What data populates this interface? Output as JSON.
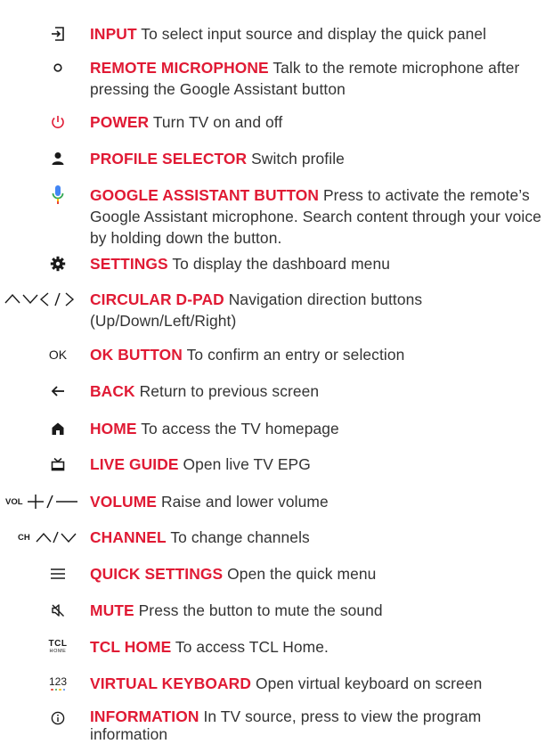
{
  "colors": {
    "accent": "#e01a34",
    "text": "#333333",
    "icon": "#1a1a1a"
  },
  "items": [
    {
      "icon": "input-icon",
      "label": "INPUT",
      "desc": "To select input source and display the quick panel"
    },
    {
      "icon": "microphone-dot-icon",
      "label": "REMOTE MICROPHONE",
      "desc": "Talk to the remote microphone after pressing the Google Assistant button"
    },
    {
      "icon": "power-icon",
      "label": "POWER",
      "desc": "Turn TV on and off"
    },
    {
      "icon": "profile-icon",
      "label": "PROFILE SELECTOR",
      "desc": "Switch profile"
    },
    {
      "icon": "google-assistant-icon",
      "label": "GOOGLE ASSISTANT BUTTON",
      "desc": "Press to activate the remote’s Google Assistant microphone. Search content through your voice by holding down the button."
    },
    {
      "icon": "settings-gear-icon",
      "label": "SETTINGS",
      "desc": "To display the dashboard menu"
    },
    {
      "icon": "dpad-arrows-icon",
      "label": "CIRCULAR D-PAD",
      "desc": "Navigation direction buttons (Up/Down/Left/Right)"
    },
    {
      "icon": "ok-icon",
      "icon_text": "OK",
      "label": "OK BUTTON",
      "desc": "To confirm an entry or selection"
    },
    {
      "icon": "back-arrow-icon",
      "label": "BACK",
      "desc": "Return to previous screen"
    },
    {
      "icon": "home-icon",
      "label": "HOME",
      "desc": "To access the TV homepage"
    },
    {
      "icon": "live-guide-icon",
      "label": "LIVE GUIDE",
      "desc": "Open live TV EPG"
    },
    {
      "icon": "volume-icon",
      "icon_text": "VOL",
      "label": "VOLUME",
      "desc": "Raise and lower volume"
    },
    {
      "icon": "channel-icon",
      "icon_text": "CH",
      "label": "CHANNEL",
      "desc": "To change channels"
    },
    {
      "icon": "menu-lines-icon",
      "label": "QUICK SETTINGS",
      "desc": "Open the quick menu"
    },
    {
      "icon": "mute-icon",
      "label": "MUTE",
      "desc": "Press the button to mute the sound"
    },
    {
      "icon": "tcl-home-icon",
      "icon_text": "TCL",
      "icon_subtext": "HOME",
      "label": "TCL HOME",
      "desc": "To access TCL Home."
    },
    {
      "icon": "virtual-keyboard-icon",
      "icon_text": "123",
      "label": "VIRTUAL KEYBOARD",
      "desc": "Open virtual keyboard on screen"
    },
    {
      "icon": "information-icon",
      "label": "INFORMATION",
      "desc": "In TV source, press to view the program information"
    }
  ]
}
